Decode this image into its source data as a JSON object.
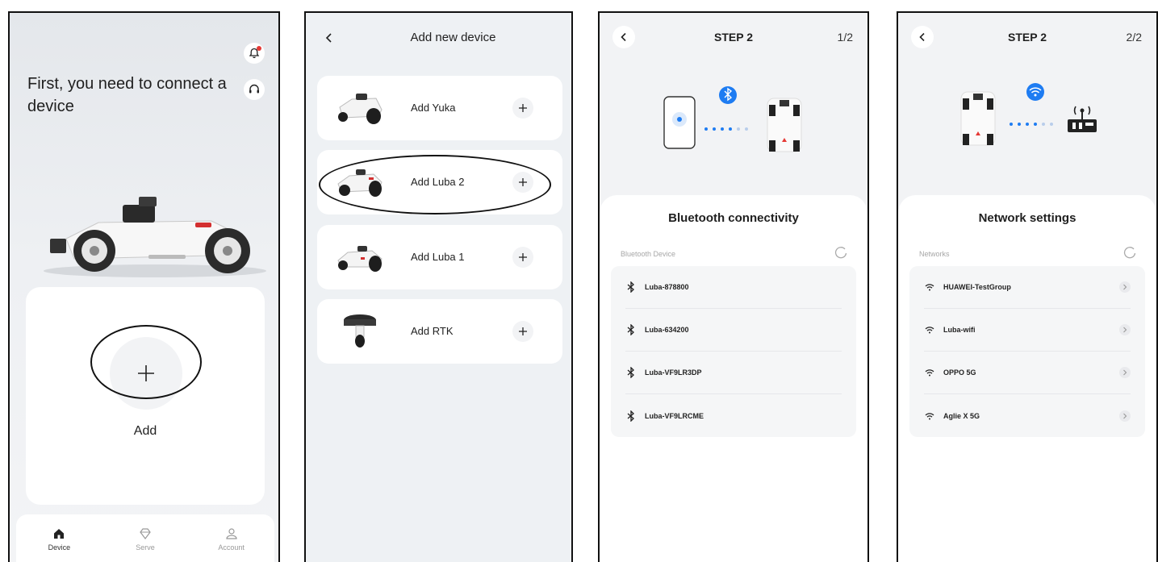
{
  "home": {
    "title": "First, you need to connect a device",
    "add_label": "Add",
    "tabs": [
      {
        "label": "Device",
        "icon": "home-icon"
      },
      {
        "label": "Serve",
        "icon": "diamond-icon"
      },
      {
        "label": "Account",
        "icon": "person-icon"
      }
    ]
  },
  "add_device": {
    "title": "Add new device",
    "devices": [
      {
        "label": "Add Yuka"
      },
      {
        "label": "Add Luba 2"
      },
      {
        "label": "Add Luba 1"
      },
      {
        "label": "Add RTK"
      }
    ]
  },
  "step_bluetooth": {
    "title": "STEP 2",
    "count": "1/2",
    "sheet_title": "Bluetooth connectivity",
    "list_label": "Bluetooth Device",
    "devices": [
      "Luba-878800",
      "Luba-634200",
      "Luba-VF9LR3DP",
      "Luba-VF9LRCME"
    ]
  },
  "step_network": {
    "title": "STEP 2",
    "count": "2/2",
    "sheet_title": "Network settings",
    "list_label": "Networks",
    "networks": [
      "HUAWEI-TestGroup",
      "Luba-wifi",
      "OPPO 5G",
      "Aglie X 5G"
    ]
  },
  "colors": {
    "accent_blue": "#1e7cf2",
    "notification_red": "#e53935",
    "highlight_ring": "#111111"
  }
}
